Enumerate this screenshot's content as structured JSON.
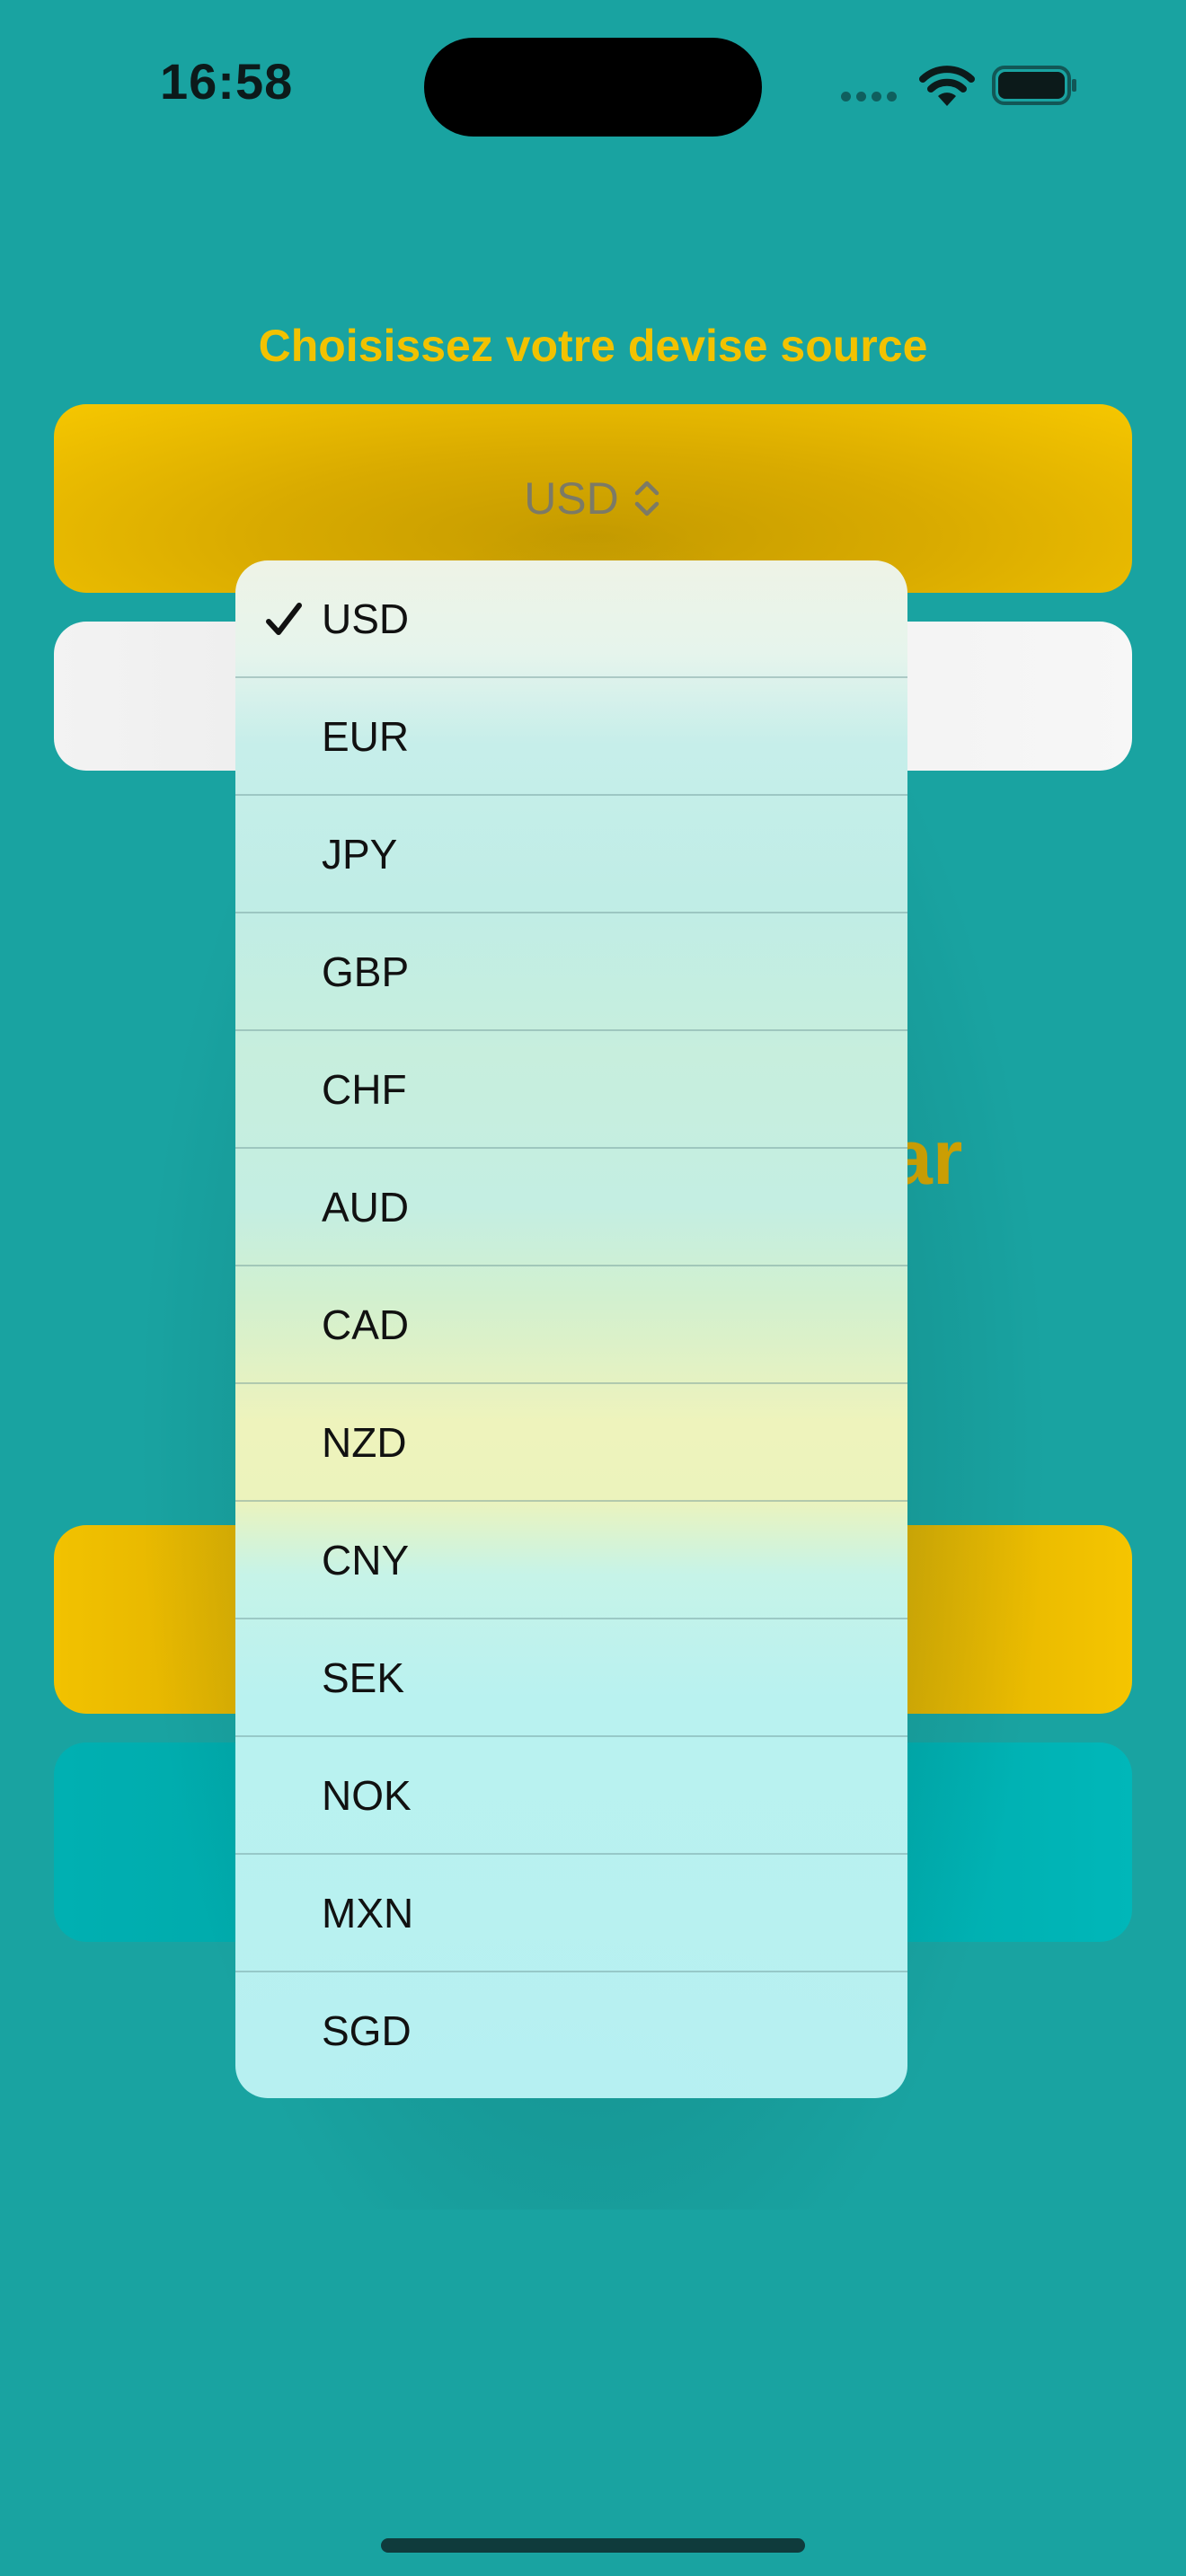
{
  "status_bar": {
    "time": "16:58"
  },
  "converter": {
    "source_label": "Choisissez votre devise source",
    "source_value": "USD",
    "convert_text_partial": "ar"
  },
  "menu": {
    "selected": "USD",
    "items": [
      "USD",
      "EUR",
      "JPY",
      "GBP",
      "CHF",
      "AUD",
      "CAD",
      "NZD",
      "CNY",
      "SEK",
      "NOK",
      "MXN",
      "SGD"
    ]
  },
  "colors": {
    "background": "#19a3a1",
    "accent_yellow": "#f2c200",
    "accent_teal": "#00aaab"
  },
  "icons": {
    "checkmark": "checkmark-icon",
    "updown": "chevron-updown-icon",
    "wifi": "wifi-icon",
    "battery": "battery-icon"
  }
}
